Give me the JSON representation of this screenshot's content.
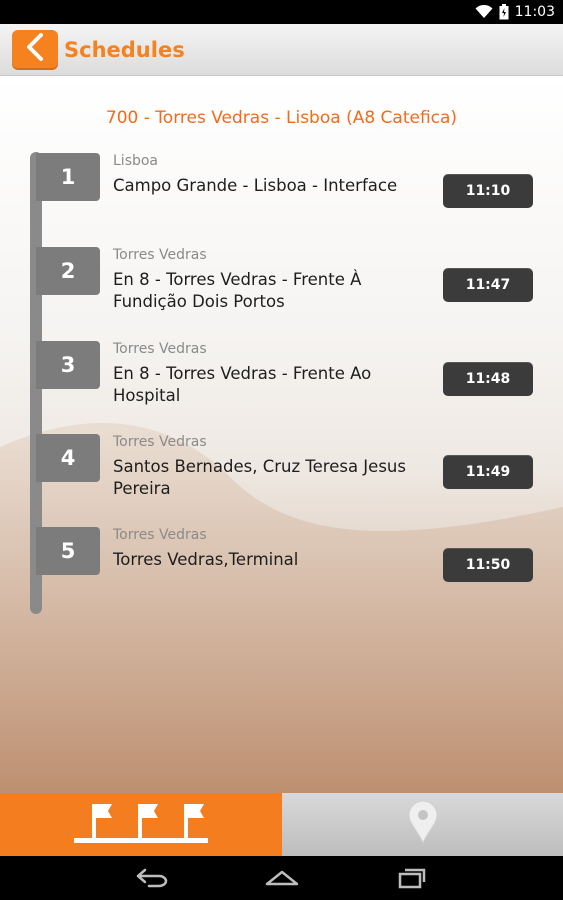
{
  "status_bar": {
    "time": "11:03"
  },
  "action_bar": {
    "title": "Schedules"
  },
  "route": {
    "title": "700 - Torres Vedras - Lisboa (A8 Catefica)"
  },
  "stops": [
    {
      "number": "1",
      "city": "Lisboa",
      "name": "Campo Grande - Lisboa - Interface",
      "time": "11:10"
    },
    {
      "number": "2",
      "city": "Torres Vedras",
      "name": "En 8 - Torres Vedras - Frente À Fundição Dois Portos",
      "time": "11:47"
    },
    {
      "number": "3",
      "city": "Torres Vedras",
      "name": "En 8 - Torres Vedras - Frente Ao Hospital",
      "time": "11:48"
    },
    {
      "number": "4",
      "city": "Torres Vedras",
      "name": "Santos Bernades, Cruz Teresa Jesus Pereira",
      "time": "11:49"
    },
    {
      "number": "5",
      "city": "Torres Vedras",
      "name": "Torres Vedras,Terminal",
      "time": "11:50"
    }
  ],
  "tabs": [
    {
      "icon": "flags-icon",
      "active": true
    },
    {
      "icon": "map-pin-icon",
      "active": false
    }
  ],
  "colors": {
    "accent": "#f5821f",
    "time_bg": "#3b3b3b",
    "badge_bg": "#7c7c7c"
  }
}
